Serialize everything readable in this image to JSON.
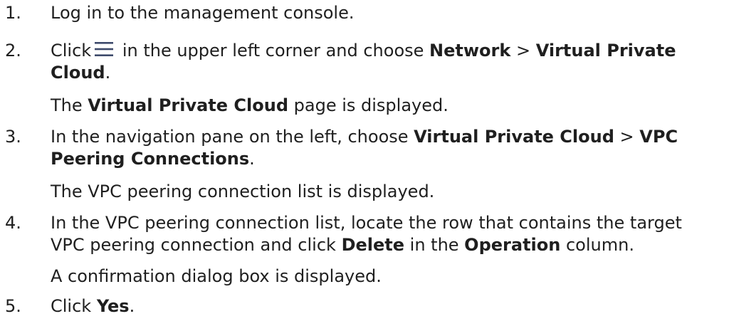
{
  "steps": [
    {
      "number": "1.",
      "text": "Log in to the management console."
    },
    {
      "number": "2.",
      "pre_icon": "Click",
      "icon": "menu-icon",
      "post_icon": " in the upper left corner and choose ",
      "bold1": "Network",
      "sep": " > ",
      "bold2": "Virtual Private Cloud",
      "end": ".",
      "note_bold": "Virtual Private Cloud",
      "note_pre": "The ",
      "note_post": " page is displayed."
    },
    {
      "number": "3.",
      "pre": "In the navigation pane on the left, choose ",
      "bold1": "Virtual Private Cloud",
      "sep": " > ",
      "bold2": "VPC Peering Connections",
      "end": ".",
      "note": "The VPC peering connection list is displayed."
    },
    {
      "number": "4.",
      "pre": "In the VPC peering connection list, locate the row that contains the target VPC peering connection and click ",
      "bold1": "Delete",
      "mid": " in the ",
      "bold2": "Operation",
      "end": " column.",
      "note": "A confirmation dialog box is displayed."
    },
    {
      "number": "5.",
      "pre": "Click ",
      "bold1": "Yes",
      "end": "."
    }
  ]
}
